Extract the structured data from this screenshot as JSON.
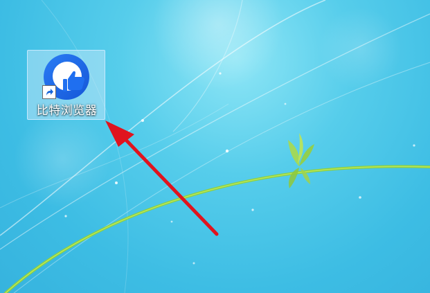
{
  "desktop": {
    "shortcut": {
      "label": "比特浏览器",
      "icon": "bitbrowser-logo-icon",
      "badge_icon": "shortcut-arrow-icon"
    },
    "annotation": {
      "icon": "red-arrow-icon",
      "color": "#e0141e"
    },
    "colors": {
      "wallpaper": "#4cc6e8",
      "brand_blue": "#1f6ff0"
    }
  }
}
